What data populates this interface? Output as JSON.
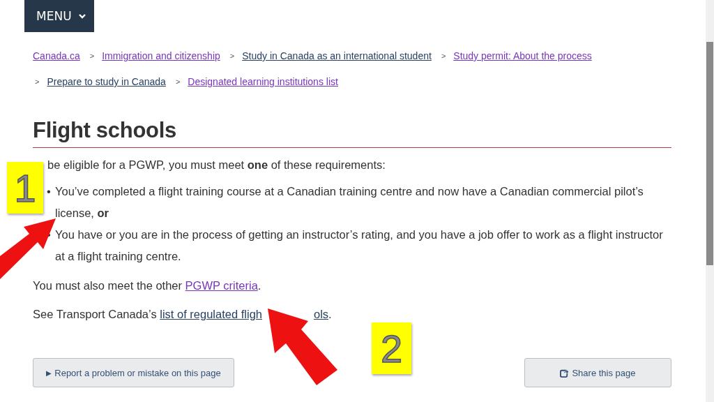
{
  "menu_button": {
    "label": "MENU"
  },
  "breadcrumbs": [
    {
      "label": "Canada.ca",
      "visited": true
    },
    {
      "label": "Immigration and citizenship",
      "visited": true,
      "separator": ">"
    },
    {
      "label": "Study in Canada as an international student",
      "visited": false,
      "separator": ">"
    },
    {
      "label": "Study permit: About the process",
      "visited": true,
      "separator": ">"
    },
    {
      "label": "Prepare to study in Canada",
      "visited": false,
      "separator": ">"
    },
    {
      "label": "Designated learning institutions list",
      "visited": true,
      "separator": ">"
    }
  ],
  "heading": "Flight schools",
  "intro": "be eligible for a PGWP, you must meet **one** of these requirements:",
  "bullet": "•",
  "requirements": [
    "You’ve completed a flight training course at a Canadian training centre and now have a Canadian commercial pilot’s license, **or**",
    "You have or you are in the process of getting an instructor’s rating, and you have a job offer to work as a flight instructor at a flight training centre."
  ],
  "criteria_paragraph": {
    "before": "You must also meet the other ",
    "link": {
      "label": "PGWP criteria",
      "visited": true
    },
    "after": "."
  },
  "transport_paragraph": {
    "before": "See Transport Canada’s ",
    "link_parts": [
      "list of regulated fligh",
      "ols"
    ],
    "link_visited": false,
    "after": "."
  },
  "annotation_badges": [
    {
      "label": "1"
    },
    {
      "label": "2"
    }
  ],
  "footer_buttons": [
    {
      "label": "Report a problem or mistake on this page",
      "icon": "▶",
      "kind": "report"
    },
    {
      "label": "Share this page",
      "kind": "share"
    }
  ]
}
